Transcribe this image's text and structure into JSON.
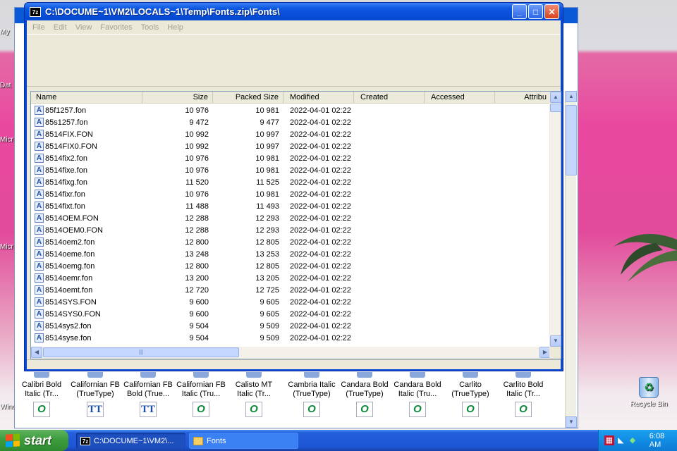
{
  "desktop": {
    "left_labels": [
      "My",
      "Dat",
      "Micr",
      "Micr",
      "Wind"
    ],
    "recycle_bin": "Recycle Bin"
  },
  "background_window": {
    "font_icons": [
      {
        "l1": "Calibri Bold",
        "l2": "Italic (Tr...",
        "type": "o"
      },
      {
        "l1": "Californian FB",
        "l2": "(TrueType)",
        "type": "tt"
      },
      {
        "l1": "Californian FB",
        "l2": "Bold (True...",
        "type": "tt"
      },
      {
        "l1": "Californian FB",
        "l2": "Italic (Tru...",
        "type": "o"
      },
      {
        "l1": "Calisto MT",
        "l2": "Italic (Tr...",
        "type": "o"
      },
      {
        "l1": "Cambria Italic",
        "l2": "(TrueType)",
        "type": "o"
      },
      {
        "l1": "Candara Bold",
        "l2": "(TrueType)",
        "type": "o"
      },
      {
        "l1": "Candara Bold",
        "l2": "Italic (Tru...",
        "type": "o"
      },
      {
        "l1": "Carlito",
        "l2": "(TrueType)",
        "type": "o"
      },
      {
        "l1": "Carlito Bold",
        "l2": "Italic (Tr...",
        "type": "o"
      }
    ]
  },
  "window": {
    "app_icon": "7z",
    "title": "C:\\DOCUME~1\\VM2\\LOCALS~1\\Temp\\Fonts.zip\\Fonts\\",
    "menu": [
      "File",
      "Edit",
      "View",
      "Favorites",
      "Tools",
      "Help"
    ],
    "columns": {
      "name": "Name",
      "size": "Size",
      "packed": "Packed Size",
      "modified": "Modified",
      "created": "Created",
      "accessed": "Accessed",
      "attributes": "Attribu"
    },
    "rows": [
      {
        "name": "85f1257.fon",
        "size": "10 976",
        "packed": "10 981",
        "modified": "2022-04-01 02:22"
      },
      {
        "name": "85s1257.fon",
        "size": "9 472",
        "packed": "9 477",
        "modified": "2022-04-01 02:22"
      },
      {
        "name": "8514FIX.FON",
        "size": "10 992",
        "packed": "10 997",
        "modified": "2022-04-01 02:22"
      },
      {
        "name": "8514FIX0.FON",
        "size": "10 992",
        "packed": "10 997",
        "modified": "2022-04-01 02:22"
      },
      {
        "name": "8514fix2.fon",
        "size": "10 976",
        "packed": "10 981",
        "modified": "2022-04-01 02:22"
      },
      {
        "name": "8514fixe.fon",
        "size": "10 976",
        "packed": "10 981",
        "modified": "2022-04-01 02:22"
      },
      {
        "name": "8514fixg.fon",
        "size": "11 520",
        "packed": "11 525",
        "modified": "2022-04-01 02:22"
      },
      {
        "name": "8514fixr.fon",
        "size": "10 976",
        "packed": "10 981",
        "modified": "2022-04-01 02:22"
      },
      {
        "name": "8514fixt.fon",
        "size": "11 488",
        "packed": "11 493",
        "modified": "2022-04-01 02:22"
      },
      {
        "name": "8514OEM.FON",
        "size": "12 288",
        "packed": "12 293",
        "modified": "2022-04-01 02:22"
      },
      {
        "name": "8514OEM0.FON",
        "size": "12 288",
        "packed": "12 293",
        "modified": "2022-04-01 02:22"
      },
      {
        "name": "8514oem2.fon",
        "size": "12 800",
        "packed": "12 805",
        "modified": "2022-04-01 02:22"
      },
      {
        "name": "8514oeme.fon",
        "size": "13 248",
        "packed": "13 253",
        "modified": "2022-04-01 02:22"
      },
      {
        "name": "8514oemg.fon",
        "size": "12 800",
        "packed": "12 805",
        "modified": "2022-04-01 02:22"
      },
      {
        "name": "8514oemr.fon",
        "size": "13 200",
        "packed": "13 205",
        "modified": "2022-04-01 02:22"
      },
      {
        "name": "8514oemt.fon",
        "size": "12 720",
        "packed": "12 725",
        "modified": "2022-04-01 02:22"
      },
      {
        "name": "8514SYS.FON",
        "size": "9 600",
        "packed": "9 605",
        "modified": "2022-04-01 02:22"
      },
      {
        "name": "8514SYS0.FON",
        "size": "9 600",
        "packed": "9 605",
        "modified": "2022-04-01 02:22"
      },
      {
        "name": "8514sys2.fon",
        "size": "9 504",
        "packed": "9 509",
        "modified": "2022-04-01 02:22"
      },
      {
        "name": "8514syse.fon",
        "size": "9 504",
        "packed": "9 509",
        "modified": "2022-04-01 02:22"
      }
    ]
  },
  "taskbar": {
    "start_label": "start",
    "tasks": [
      {
        "label": "C:\\DOCUME~1\\VM2\\...",
        "icon": "7z"
      },
      {
        "label": "Fonts",
        "icon": "folder"
      }
    ],
    "clock": "6:08 AM"
  },
  "colors": {
    "titlebar": "#0a49d4",
    "window_face": "#ece9d8",
    "taskbar": "#245edb",
    "start_button": "#3c9a3c",
    "tray": "#118ce4"
  }
}
